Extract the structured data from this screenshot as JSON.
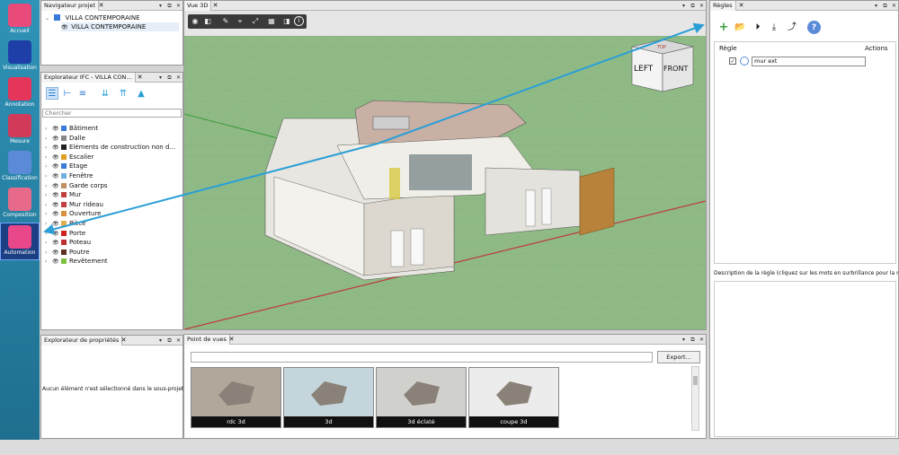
{
  "nav": [
    {
      "label": "Accueil",
      "icon": "home-icon",
      "color": "#e84a7a"
    },
    {
      "label": "Visualisation",
      "icon": "eye-icon",
      "color": "#1e3fa8"
    },
    {
      "label": "Annotation",
      "icon": "annotation-icon",
      "color": "#e6355a"
    },
    {
      "label": "Mesure",
      "icon": "measure-icon",
      "color": "#d23a5a"
    },
    {
      "label": "Classification",
      "icon": "classification-icon",
      "color": "#5a8ad8"
    },
    {
      "label": "Composition",
      "icon": "composition-icon",
      "color": "#e86a8a"
    },
    {
      "label": "Automation",
      "icon": "gear-icon",
      "color": "#e8488a"
    }
  ],
  "project_nav": {
    "title": "Navigateur projet",
    "root": "VILLA CONTEMPORAINE",
    "child": "VILLA CONTEMPORAINE"
  },
  "ifc_explorer": {
    "title": "Explorateur IFC - VILLA CON...",
    "search_placeholder": "Chercher",
    "items": [
      {
        "label": "Bâtiment",
        "color": "#3a7ad8"
      },
      {
        "label": "Dalle",
        "color": "#888888"
      },
      {
        "label": "Eléments de construction non d...",
        "color": "#222222"
      },
      {
        "label": "Escalier",
        "color": "#e0a020"
      },
      {
        "label": "Etage",
        "color": "#3a7ad8"
      },
      {
        "label": "Fenêtre",
        "color": "#70b0e0"
      },
      {
        "label": "Garde corps",
        "color": "#c09060"
      },
      {
        "label": "Mur",
        "color": "#c04040"
      },
      {
        "label": "Mur rideau",
        "color": "#c04040"
      },
      {
        "label": "Ouverture",
        "color": "#d89040"
      },
      {
        "label": "Pièce",
        "color": "#e0b050"
      },
      {
        "label": "Porte",
        "color": "#d02020"
      },
      {
        "label": "Poteau",
        "color": "#c03030"
      },
      {
        "label": "Poutre",
        "color": "#603020"
      },
      {
        "label": "Revêtement",
        "color": "#80c040"
      }
    ]
  },
  "properties": {
    "title": "Explorateur de propriétés",
    "message": "Aucun élément n'est sélectionné dans le sous-projet"
  },
  "view3d": {
    "title": "Vue 3D",
    "cube_left": "LEFT",
    "cube_front": "FRONT",
    "cube_top": "TOP"
  },
  "viewpoints": {
    "title": "Point de vues",
    "export_label": "Export...",
    "thumbs": [
      "rdc 3d",
      "3d",
      "3d éclaté",
      "coupe 3d"
    ]
  },
  "rules": {
    "title": "Règles",
    "col_rule": "Règle",
    "col_actions": "Actions",
    "items": [
      {
        "label": "mur ext",
        "checked": true
      }
    ],
    "description_label": "Description de la règle (cliquez sur les mots en surbrillance pour la m"
  },
  "colors": {
    "accent": "#2a9fd6",
    "grid_bg": "#8fba85"
  }
}
